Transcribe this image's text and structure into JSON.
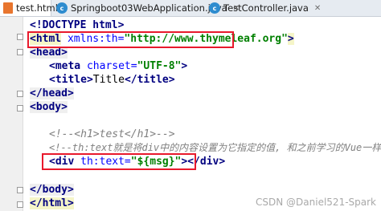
{
  "tabs": [
    {
      "label": "test.html",
      "icon": "html-file-icon",
      "active": true
    },
    {
      "label": "Springboot03WebApplication.java",
      "icon": "java-class-icon",
      "active": false
    },
    {
      "label": "TestController.java",
      "icon": "java-class-icon",
      "active": false
    }
  ],
  "code": {
    "l1": {
      "decl": "<!DOCTYPE",
      "name": " html",
      "end": ">"
    },
    "l2": {
      "open": "<html",
      "attr": " xmlns:th=",
      "val": "\"http://www.thymeleaf.org\"",
      "close": ">"
    },
    "l3": {
      "tag": "<head>"
    },
    "l4": {
      "open": "<meta",
      "attr": " charset=",
      "val": "\"UTF-8\"",
      "close": ">"
    },
    "l5": {
      "open": "<title>",
      "text": "Title",
      "close": "</title>"
    },
    "l6": {
      "tag": "</head>"
    },
    "l7": {
      "tag": "<body>"
    },
    "l8": {
      "comment": "<!--<h1>test</h1>-->"
    },
    "l9": {
      "comment": "<!--th:text就是将div中的内容设置为它指定的值, 和之前学习的Vue一样-->"
    },
    "l10": {
      "open": "<div",
      "attr": " th:text=",
      "val": "\"${msg}\"",
      "close": "></div>"
    },
    "l11": {
      "tag": "</body>"
    },
    "l12": {
      "tag": "</html>"
    }
  },
  "watermark": "CSDN @Daniel521-Spark",
  "colors": {
    "highlight_box": "#e8192c",
    "tag": "#000080",
    "attribute": "#0000ff",
    "string": "#008000",
    "comment": "#808080"
  }
}
